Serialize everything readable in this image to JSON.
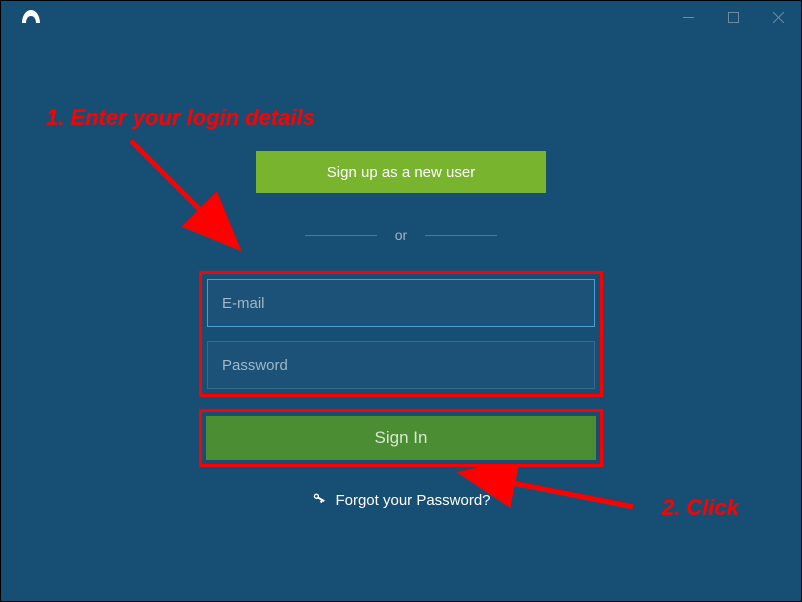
{
  "window": {
    "minimize": "—",
    "maximize": "▢",
    "close": "✕"
  },
  "signup_label": "Sign up as a new user",
  "divider_text": "or",
  "email_placeholder": "E-mail",
  "password_placeholder": "Password",
  "signin_label": "Sign In",
  "forgot_label": "Forgot your Password?",
  "annotations": {
    "step1": "1. Enter your login details",
    "step2": "2. Click"
  }
}
